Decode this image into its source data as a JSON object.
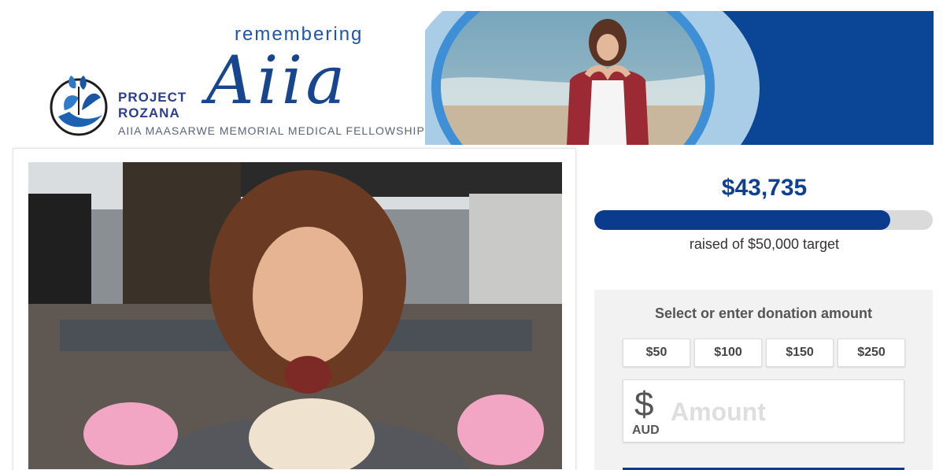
{
  "banner": {
    "logo_line1": "PROJECT",
    "logo_line2": "ROZANA",
    "remembering": "remembering",
    "name_script": "Aiia",
    "fellowship": "AIIA MAASARWE MEMORIAL MEDICAL FELLOWSHIP",
    "colors": {
      "navy": "#0b4596",
      "light_blue": "#a9cde6",
      "accent_blue": "#3f8fd6"
    }
  },
  "campaign": {
    "raised": "$43,735",
    "caption": "raised of $50,000 target",
    "progress_fraction": 0.8747
  },
  "donation": {
    "title": "Select or enter donation amount",
    "preset_amounts": [
      "$50",
      "$100",
      "$150",
      "$250"
    ],
    "currency_symbol": "$",
    "currency_code": "AUD",
    "amount_placeholder": "Amount",
    "amount_value": ""
  },
  "icons": [
    "project-rozana-logo-icon",
    "dollar-sign-icon"
  ]
}
